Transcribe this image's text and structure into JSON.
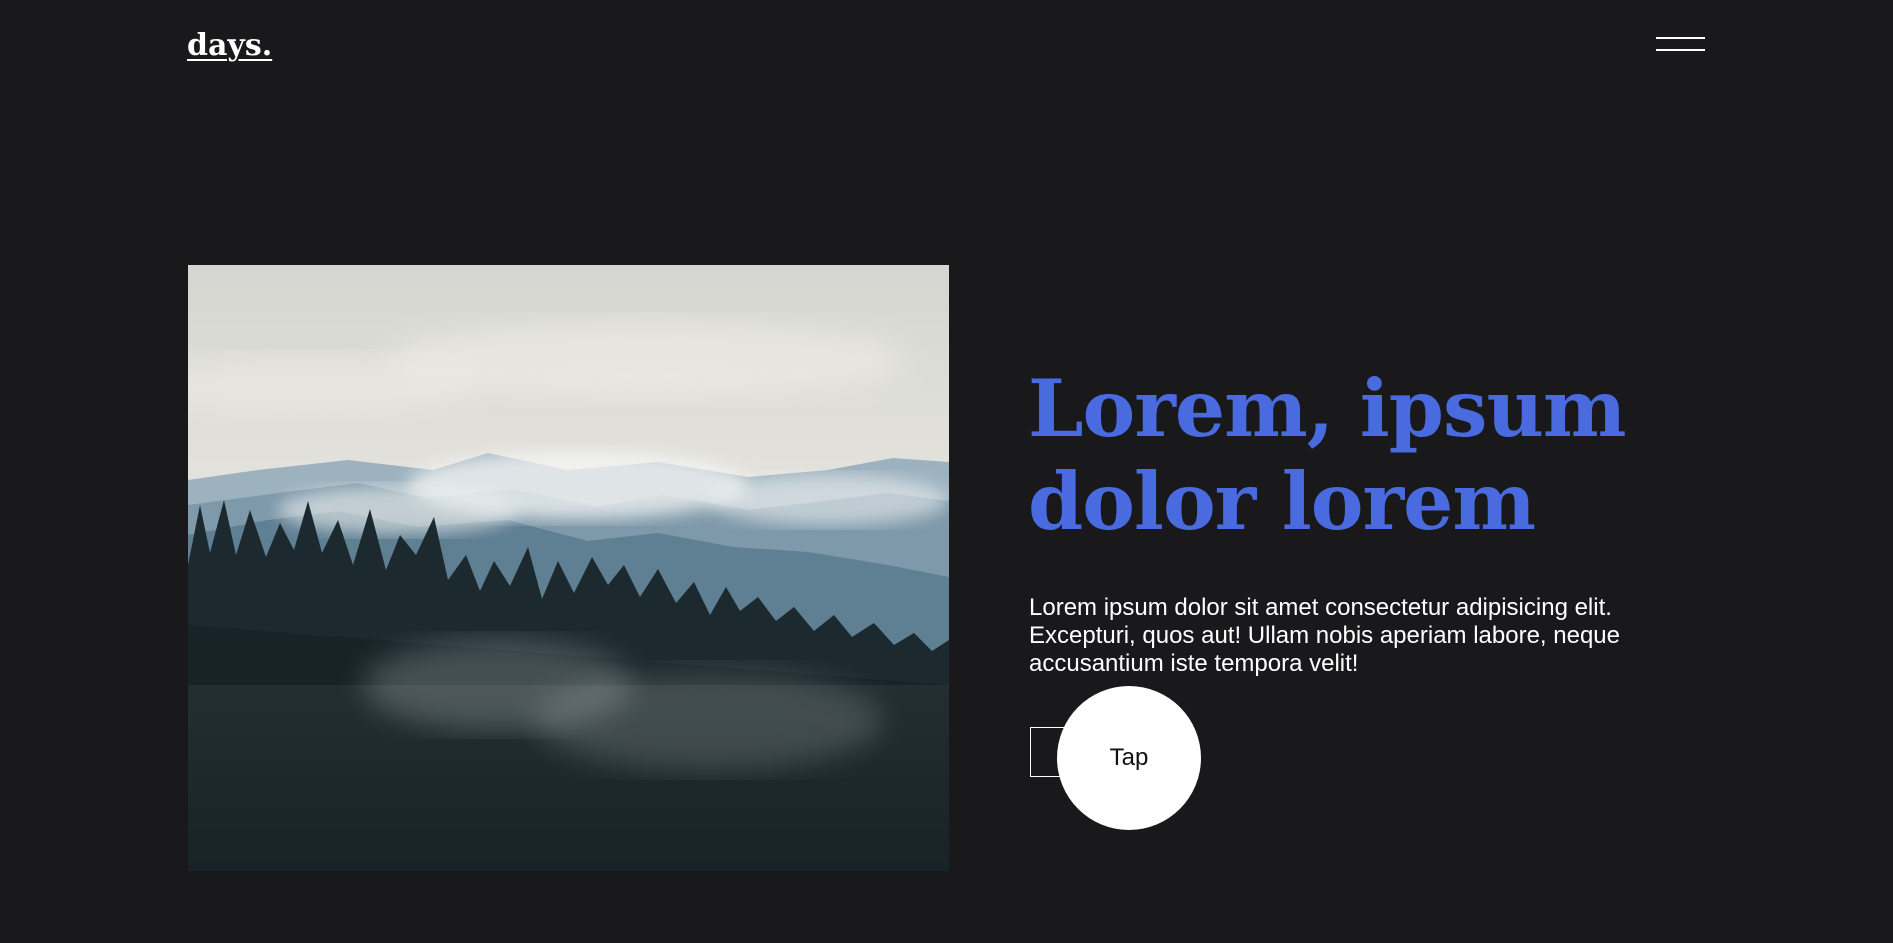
{
  "header": {
    "logo": "days.",
    "menu_icon": "hamburger-menu-icon"
  },
  "hero": {
    "image_subject": "misty mountains and pine forest",
    "headline": "Lorem, ipsum dolor lorem",
    "body": "Lorem ipsum dolor sit amet consectetur adipisicing elit. Excepturi, quos aut! Ullam nobis aperiam labore, neque accusantium iste tempora velit!",
    "tap_label": "Tap"
  },
  "colors": {
    "background": "#19191b",
    "accent": "#4a6be0",
    "text": "#ffffff"
  }
}
